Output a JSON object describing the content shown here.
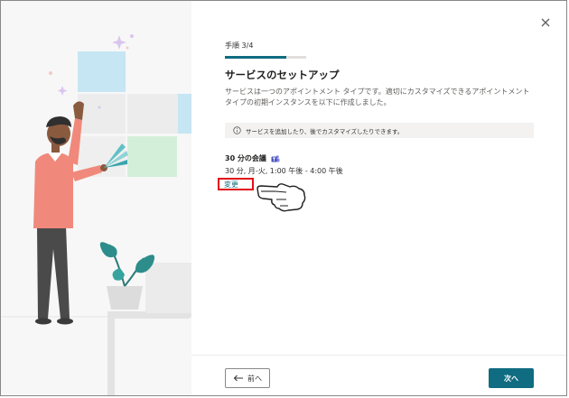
{
  "wizard": {
    "step_label": "手順 3/4",
    "progress": 0.75,
    "title": "サービスのセットアップ",
    "description": "サービスは一つのアポイントメント タイプです。適切にカスタマイズできるアポイントメント タイプの初期インスタンスを以下に作成しました。",
    "info_message": "サービスを追加したり、後でカスタマイズしたりできます。"
  },
  "service": {
    "name": "30 分の会議",
    "detail": "30 分, 月-火, 1:00 午後 - 4:00 午後",
    "change_label": "変更"
  },
  "footer": {
    "back_label": "前へ",
    "next_label": "次へ"
  },
  "colors": {
    "accent": "#0f6c81",
    "highlight": "#e0101a"
  },
  "icons": {
    "close": "close-icon",
    "info": "info-icon",
    "teams": "teams-icon",
    "back": "arrow-left-icon"
  }
}
